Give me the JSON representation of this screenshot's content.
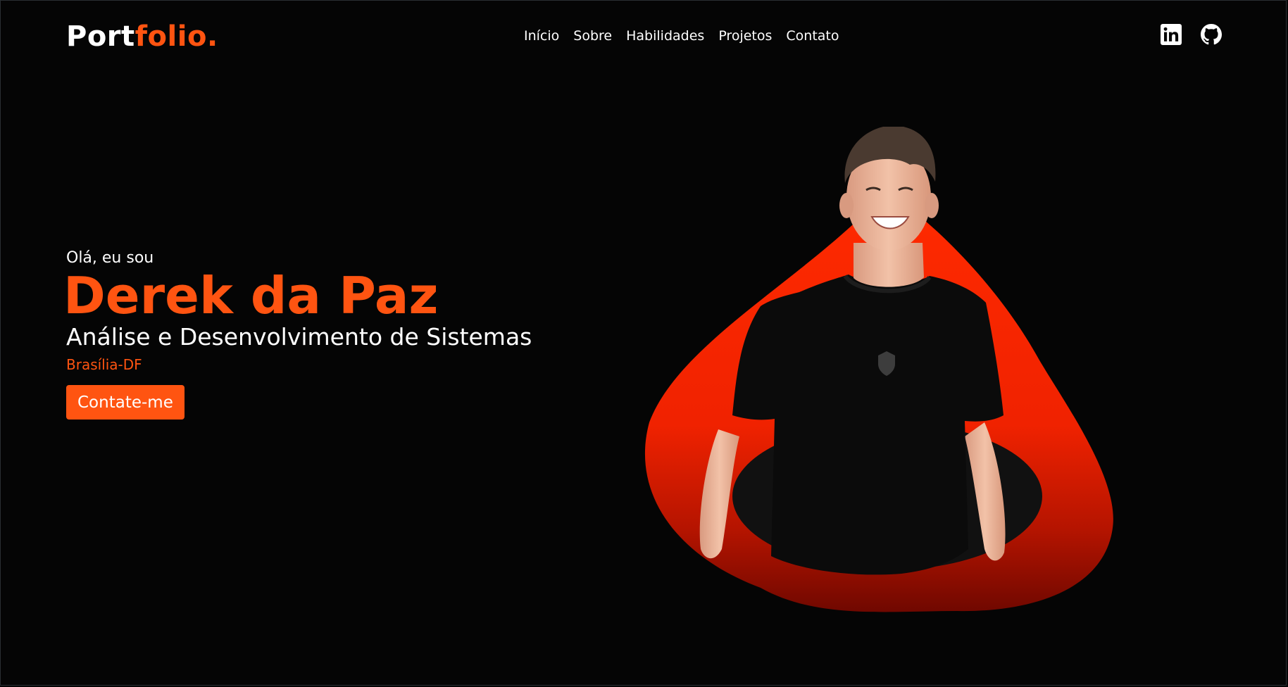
{
  "header": {
    "logo_main": "Port",
    "logo_accent": "folio."
  },
  "nav": {
    "items": [
      {
        "label": "Início"
      },
      {
        "label": "Sobre"
      },
      {
        "label": "Habilidades"
      },
      {
        "label": "Projetos"
      },
      {
        "label": "Contato"
      }
    ]
  },
  "social": {
    "icons": [
      "linkedin-icon",
      "github-icon"
    ]
  },
  "hero": {
    "greeting": "Olá, eu sou",
    "name": "Derek da Paz",
    "role": "Análise e Desenvolvimento de Sistemas",
    "location": "Brasília-DF",
    "cta_label": "Contate-me"
  },
  "colors": {
    "background": "#050505",
    "accent": "#ff5411",
    "blob_top": "#ff2a00",
    "blob_bottom": "#7a0a00",
    "text": "#ffffff"
  }
}
